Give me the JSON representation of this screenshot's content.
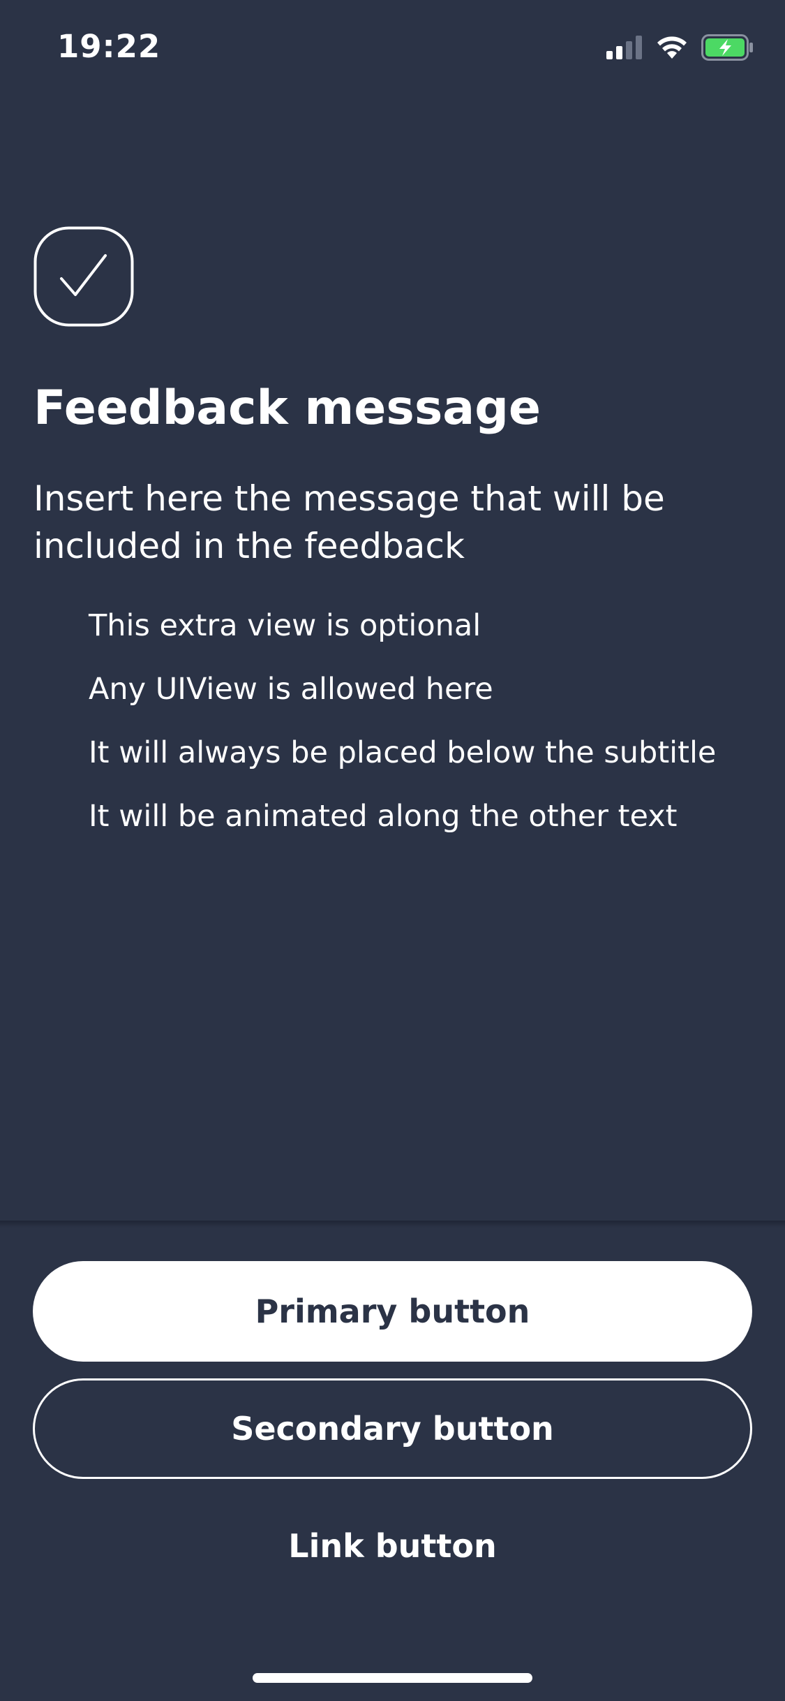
{
  "status_bar": {
    "time": "19:22",
    "icons": [
      "cellular-signal-icon",
      "wifi-icon",
      "battery-charging-icon"
    ]
  },
  "feedback": {
    "icon": "checkmark-icon",
    "title": "Feedback message",
    "subtitle": "Insert here the message that will be included in the feedback",
    "extra_items": [
      "This extra view is optional",
      "Any UIView is allowed here",
      "It will always be placed below the subtitle",
      "It will be animated along the other text"
    ]
  },
  "actions": {
    "primary_label": "Primary button",
    "secondary_label": "Secondary button",
    "link_label": "Link button"
  },
  "colors": {
    "background": "#2b3346",
    "foreground": "#ffffff",
    "battery_green": "#4cd964"
  }
}
